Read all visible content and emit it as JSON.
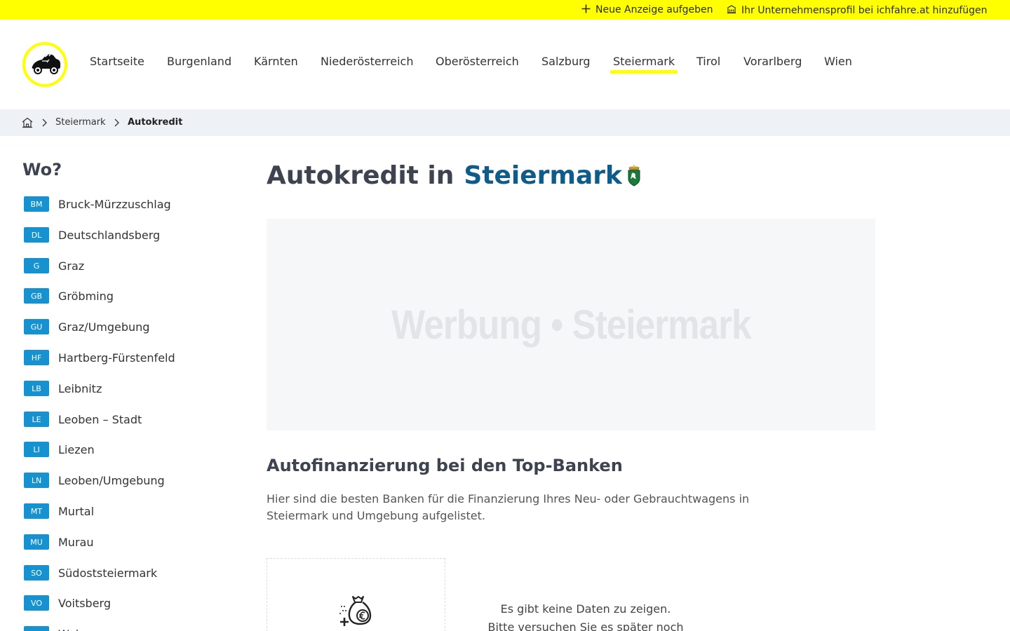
{
  "topbar": {
    "new_ad_label": "Neue Anzeige aufgeben",
    "add_profile_label": "Ihr Unternehmensprofil bei ichfahre.at hinzufügen",
    "background": "#ffff00"
  },
  "nav": {
    "items": [
      "Startseite",
      "Burgenland",
      "Kärnten",
      "Niederösterreich",
      "Oberösterreich",
      "Salzburg",
      "Steiermark",
      "Tirol",
      "Vorarlberg",
      "Wien"
    ],
    "active": "Steiermark"
  },
  "breadcrumb": {
    "home_icon": "home-icon",
    "items": [
      "Steiermark"
    ],
    "current": "Autokredit"
  },
  "sidebar": {
    "title": "Wo?",
    "code_color": "#1792d0",
    "districts": [
      {
        "code": "BM",
        "name": "Bruck-Mürzzuschlag"
      },
      {
        "code": "DL",
        "name": "Deutschlandsberg"
      },
      {
        "code": "G",
        "name": "Graz"
      },
      {
        "code": "GB",
        "name": "Gröbming"
      },
      {
        "code": "GU",
        "name": "Graz/Umgebung"
      },
      {
        "code": "HF",
        "name": "Hartberg-Fürstenfeld"
      },
      {
        "code": "LB",
        "name": "Leibnitz"
      },
      {
        "code": "LE",
        "name": "Leoben – Stadt"
      },
      {
        "code": "LI",
        "name": "Liezen"
      },
      {
        "code": "LN",
        "name": "Leoben/Umgebung"
      },
      {
        "code": "MT",
        "name": "Murtal"
      },
      {
        "code": "MU",
        "name": "Murau"
      },
      {
        "code": "SO",
        "name": "Südoststeiermark"
      },
      {
        "code": "VO",
        "name": "Voitsberg"
      },
      {
        "code": "WZ",
        "name": "Weiz"
      }
    ]
  },
  "main": {
    "title_prefix": "Autokredit in",
    "title_region": "Steiermark",
    "region_color": "#0f5c8a",
    "ad_text": "Werbung • Steiermark",
    "subtitle": "Autofinanzierung bei den Top-Banken",
    "description": "Hier sind die besten Banken für die Finanzierung Ihres Neu- oder Gebrauchtwagens in Steiermark und Umgebung aufgelistet.",
    "card_icon": "money-bag-euro-icon",
    "no_data_line1": "Es gibt keine Daten zu zeigen.",
    "no_data_line2": "Bitte versuchen Sie es später noch"
  }
}
